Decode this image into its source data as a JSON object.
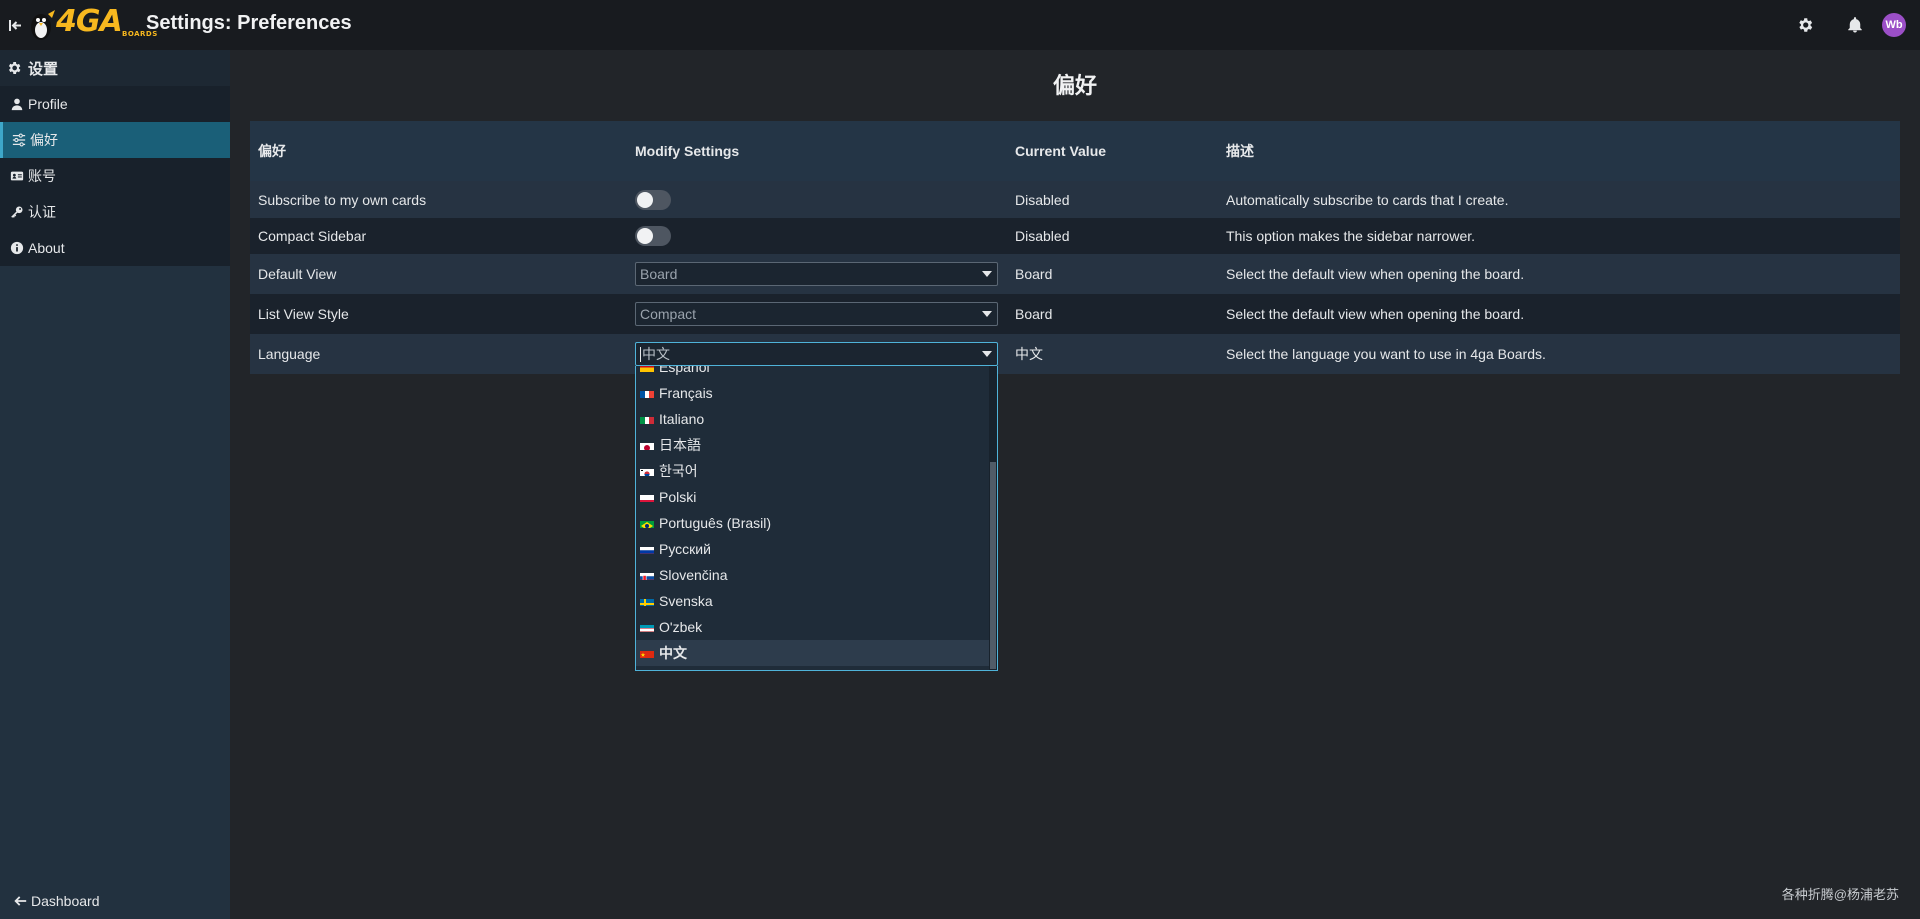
{
  "app": {
    "logo_text": "4GA",
    "logo_sub": "BOARDS",
    "page_heading": "Settings: Preferences"
  },
  "header": {
    "avatar_initials": "Wb"
  },
  "sidebar": {
    "title": "设置",
    "items": [
      {
        "label": "Profile",
        "icon": "user-icon"
      },
      {
        "label": "偏好",
        "icon": "sliders-icon"
      },
      {
        "label": "账号",
        "icon": "id-card-icon"
      },
      {
        "label": "认证",
        "icon": "key-icon"
      },
      {
        "label": "About",
        "icon": "info-icon"
      }
    ],
    "active_index": 1,
    "footer_label": "Dashboard"
  },
  "main": {
    "title": "偏好",
    "columns": [
      "偏好",
      "Modify Settings",
      "Current Value",
      "描述"
    ],
    "rows": [
      {
        "name": "Subscribe to my own cards",
        "control": "toggle",
        "value": "Disabled",
        "description": "Automatically subscribe to cards that I create."
      },
      {
        "name": "Compact Sidebar",
        "control": "toggle",
        "value": "Disabled",
        "description": "This option makes the sidebar narrower."
      },
      {
        "name": "Default View",
        "control": "select",
        "selected": "Board",
        "value": "Board",
        "description": "Select the default view when opening the board."
      },
      {
        "name": "List View Style",
        "control": "select",
        "selected": "Compact",
        "value": "Board",
        "description": "Select the default view when opening the board."
      },
      {
        "name": "Language",
        "control": "select-open",
        "selected": "中文",
        "value": "中文",
        "description": "Select the language you want to use in 4ga Boards."
      }
    ]
  },
  "language_dropdown": {
    "options": [
      {
        "label": "Español",
        "flag": "es"
      },
      {
        "label": "Français",
        "flag": "fr"
      },
      {
        "label": "Italiano",
        "flag": "it"
      },
      {
        "label": "日本語",
        "flag": "jp"
      },
      {
        "label": "한국어",
        "flag": "kr"
      },
      {
        "label": "Polski",
        "flag": "pl"
      },
      {
        "label": "Português (Brasil)",
        "flag": "br"
      },
      {
        "label": "Русский",
        "flag": "ru"
      },
      {
        "label": "Slovenčina",
        "flag": "sk"
      },
      {
        "label": "Svenska",
        "flag": "se"
      },
      {
        "label": "O'zbek",
        "flag": "uz"
      },
      {
        "label": "中文",
        "flag": "cn"
      }
    ],
    "selected_index": 11
  },
  "watermark": "各种折腾@杨浦老苏"
}
